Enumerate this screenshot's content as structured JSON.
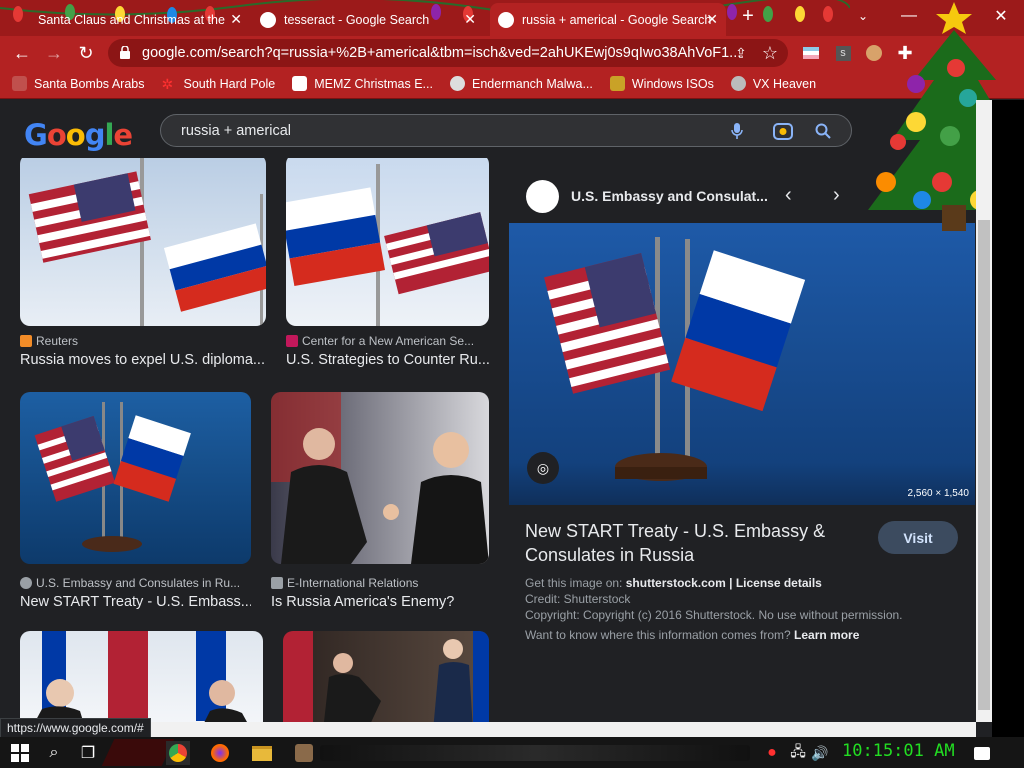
{
  "tabs": [
    {
      "title": "Santa Claus and Christmas at the",
      "active": false
    },
    {
      "title": "tesseract - Google Search",
      "active": false
    },
    {
      "title": "russia + americal - Google Search",
      "active": true
    }
  ],
  "new_tab": "+",
  "address": {
    "url": "google.com/search?q=russia+%2B+americal&tbm=isch&ved=2ahUKEwj0s9qIwo38AhVoF1..."
  },
  "bookmarks": [
    "Santa Bombs Arabs",
    "South Hard Pole",
    "MEMZ Christmas E...",
    "Endermanch Malwa...",
    "Windows ISOs",
    "VX Heaven"
  ],
  "search": {
    "query": "russia + americal"
  },
  "results": [
    {
      "source": "Reuters",
      "title": "Russia moves to expel U.S. diploma..."
    },
    {
      "source": "Center for a New American Se...",
      "title": "U.S. Strategies to Counter Ru..."
    },
    {
      "source": "U.S. Embassy and Consulates in Ru...",
      "title": "New START Treaty - U.S. Embass..."
    },
    {
      "source": "E-International Relations",
      "title": "Is Russia America's Enemy?"
    }
  ],
  "panel": {
    "site": "U.S. Embassy and Consulat...",
    "dimensions": "2,560 × 1,540",
    "title": "New START Treaty - U.S. Embassy & Consulates in Russia",
    "visit": "Visit",
    "get_image_prefix": "Get this image on:",
    "get_image_site": "shutterstock.com",
    "separator": "|",
    "license": "License details",
    "credit": "Credit: Shutterstock",
    "copyright": "Copyright: Copyright (c) 2016 Shutterstock. No use without permission.",
    "want_to_know": "Want to know where this information comes from?",
    "learn_more": "Learn more"
  },
  "status_url": "https://www.google.com/#",
  "clock": "10:15:01 AM",
  "colors": {
    "chrome_red": "#b32222",
    "dark_bg": "#202124",
    "clock_green": "#22dd22"
  }
}
